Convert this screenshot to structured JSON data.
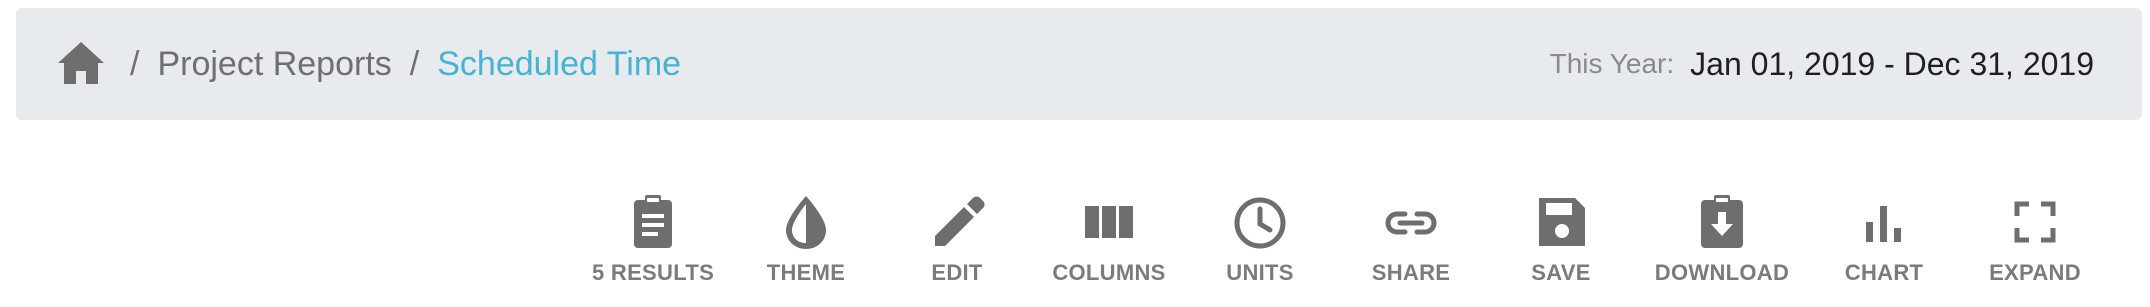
{
  "breadcrumb": {
    "home_icon": "home-icon",
    "separator": "/",
    "items": [
      {
        "label": "Project Reports",
        "active": false
      },
      {
        "label": "Scheduled Time",
        "active": true
      }
    ]
  },
  "date_range": {
    "label": "This Year:",
    "value": "Jan 01, 2019 - Dec 31, 2019"
  },
  "toolbar": {
    "items": [
      {
        "label": "5 RESULTS",
        "icon": "clipboard-list-icon"
      },
      {
        "label": "THEME",
        "icon": "droplet-icon"
      },
      {
        "label": "EDIT",
        "icon": "pencil-icon"
      },
      {
        "label": "COLUMNS",
        "icon": "columns-icon"
      },
      {
        "label": "UNITS",
        "icon": "clock-icon"
      },
      {
        "label": "SHARE",
        "icon": "link-icon"
      },
      {
        "label": "SAVE",
        "icon": "floppy-disk-icon"
      },
      {
        "label": "DOWNLOAD",
        "icon": "clipboard-download-icon"
      },
      {
        "label": "CHART",
        "icon": "bar-chart-icon"
      },
      {
        "label": "EXPAND",
        "icon": "expand-icon"
      }
    ]
  },
  "colors": {
    "header_bg": "#e8ebee",
    "breadcrumb_text": "#6f6f6f",
    "active_link": "#45b3d4",
    "icon_gray": "#6e6e6e",
    "label_gray": "#7b7b7b"
  }
}
